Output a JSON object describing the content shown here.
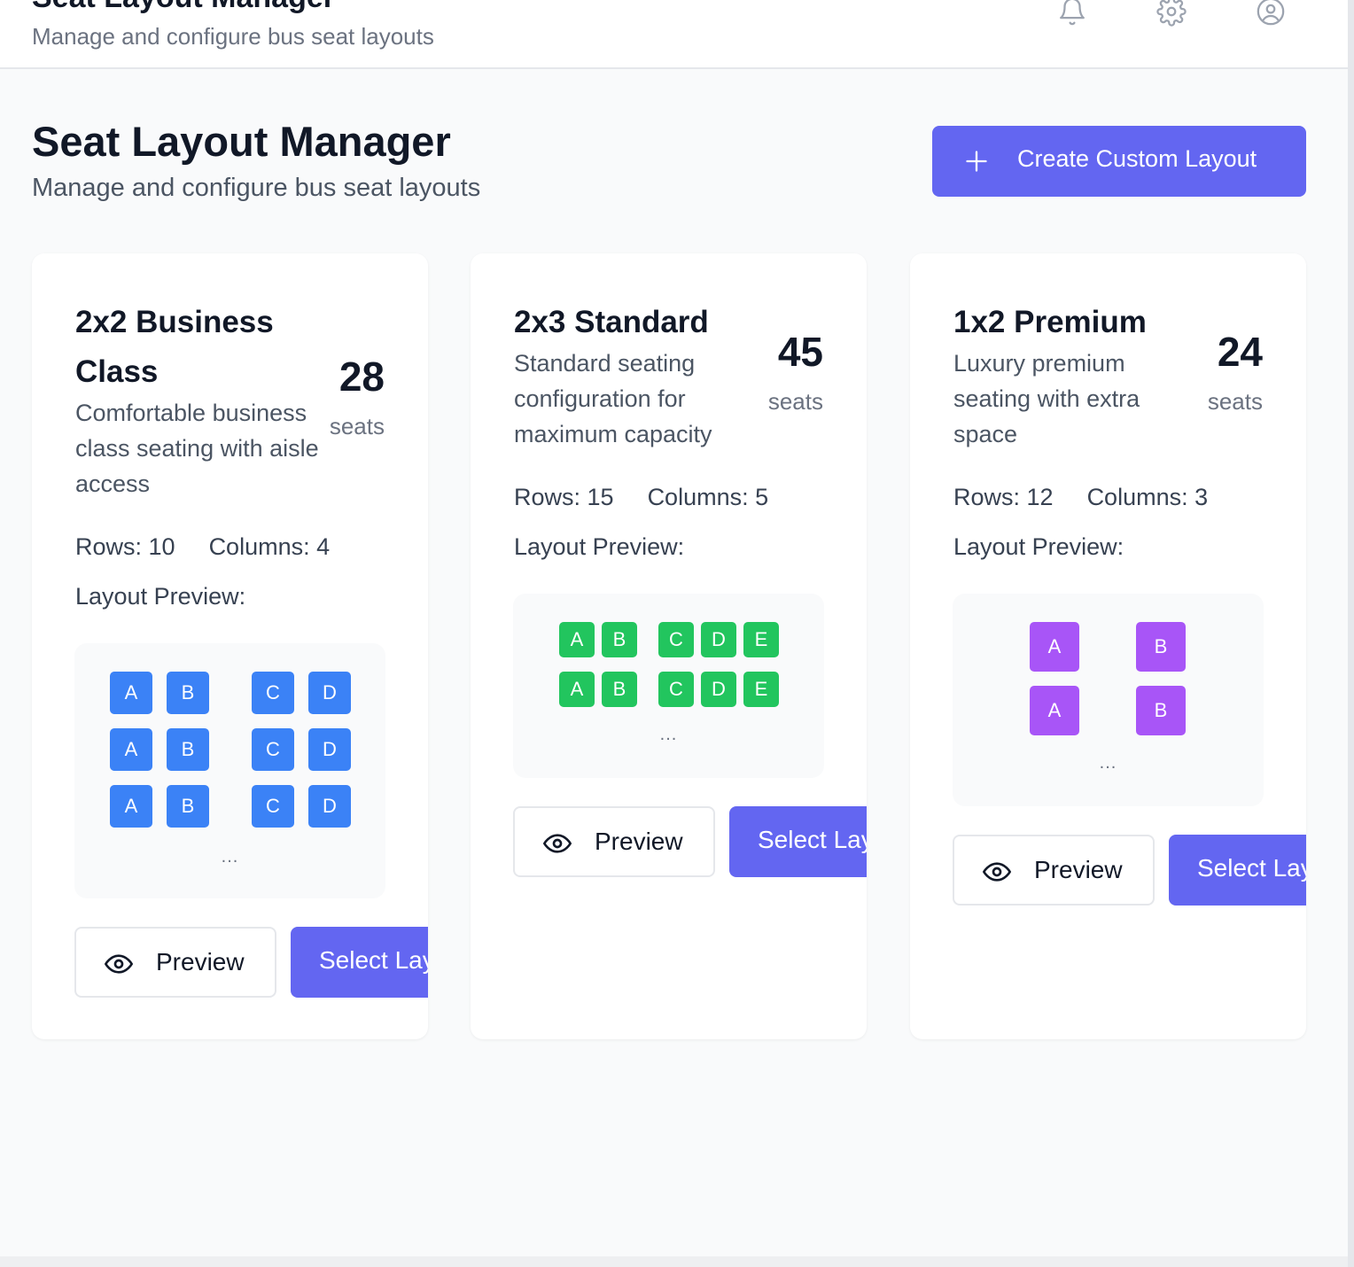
{
  "header": {
    "title": "Seat Layout Manager",
    "subtitle": "Manage and configure bus seat layouts",
    "icons": [
      "bell-icon",
      "gear-icon",
      "user-circle-icon"
    ]
  },
  "page": {
    "title": "Seat Layout Manager",
    "subtitle": "Manage and configure bus seat layouts",
    "create_button_label": "Create Custom Layout"
  },
  "colors": {
    "accent": "#6366f1",
    "business_seat": "#3b82f6",
    "standard_seat": "#22c55e",
    "premium_seat": "#a855f7"
  },
  "layouts": [
    {
      "name": "2x2 Business Class",
      "description": "Comfortable business class seating with aisle access",
      "seats": "28",
      "seats_label": "seats",
      "rows": "Rows: 10",
      "columns": "Columns: 4",
      "preview_label": "Layout Preview:",
      "preview_rows": [
        [
          "A",
          "B",
          "C",
          "D"
        ],
        [
          "A",
          "B",
          "C",
          "D"
        ],
        [
          "A",
          "B",
          "C",
          "D"
        ]
      ],
      "ellipsis": "...",
      "preview_button": "Preview",
      "select_button": "Select Layout"
    },
    {
      "name": "2x3 Standard",
      "description": "Standard seating configuration for maximum capacity",
      "seats": "45",
      "seats_label": "seats",
      "rows": "Rows: 15",
      "columns": "Columns: 5",
      "preview_label": "Layout Preview:",
      "preview_rows": [
        [
          "A",
          "B",
          "C",
          "D",
          "E"
        ],
        [
          "A",
          "B",
          "C",
          "D",
          "E"
        ]
      ],
      "ellipsis": "...",
      "preview_button": "Preview",
      "select_button": "Select Layout"
    },
    {
      "name": "1x2 Premium",
      "description": "Luxury premium seating with extra space",
      "seats": "24",
      "seats_label": "seats",
      "rows": "Rows: 12",
      "columns": "Columns: 3",
      "preview_label": "Layout Preview:",
      "preview_rows": [
        [
          "A",
          "B"
        ],
        [
          "A",
          "B"
        ]
      ],
      "ellipsis": "...",
      "preview_button": "Preview",
      "select_button": "Select Layout"
    }
  ]
}
